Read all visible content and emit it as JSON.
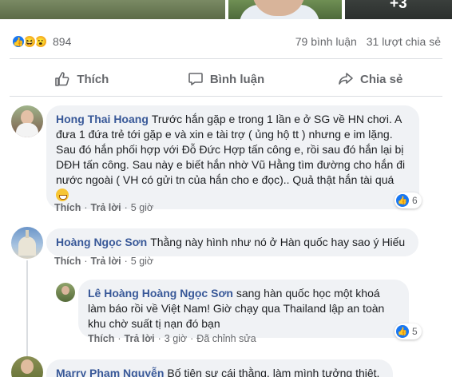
{
  "photos": {
    "more_count": "+3"
  },
  "post": {
    "reaction_count": "894",
    "comments_count": "79 bình luận",
    "shares_count": "31 lượt chia sẻ",
    "reaction_icons": [
      "like-icon",
      "haha-icon",
      "wow-icon"
    ]
  },
  "actions": {
    "like": "Thích",
    "comment": "Bình luận",
    "share": "Chia sẻ"
  },
  "comments": [
    {
      "author": "Hong Thai Hoang",
      "text": "Trước hắn gặp e trong 1 lần e ở SG về HN chơi. A đưa 1 đứa trẻ tới gặp e và xin e tài trợ ( ủng hộ tt ) nhưng e im lặng. Sau đó hắn phối hợp với Đỗ Đức Hợp tấn công e, rồi sau đó hắn lại bị DĐH tấn công. Sau này e biết hắn nhờ Vũ Hằng tìm đường cho hắn đi nước ngoài ( VH có gửi tn của hắn cho e đọc).. Quả thật hắn tài quá",
      "like": "Thích",
      "reply": "Trả lời",
      "time": "5 giờ",
      "reactions": "6"
    },
    {
      "author": "Hoàng Ngọc Sơn",
      "text": "Thằng này hình như nó ở Hàn quốc hay sao ý Hiếu",
      "like": "Thích",
      "reply": "Trả lời",
      "time": "5 giờ"
    },
    {
      "author": "Lê Hoàng",
      "mention": "Hoàng Ngọc Sơn",
      "text": "sang hàn quốc học một khoá làm báo rồi về Việt Nam! Giờ chạy qua Thailand lập an toàn khu chờ suất tị nạn đó bạn",
      "like": "Thích",
      "reply": "Trả lời",
      "time": "3 giờ",
      "edited": "Đã chỉnh sửa",
      "reactions": "5"
    },
    {
      "author": "Marry Phạm Nguyễn",
      "text": "Bố tiên sư cái thằng, làm mình tưởng thiệt."
    }
  ]
}
